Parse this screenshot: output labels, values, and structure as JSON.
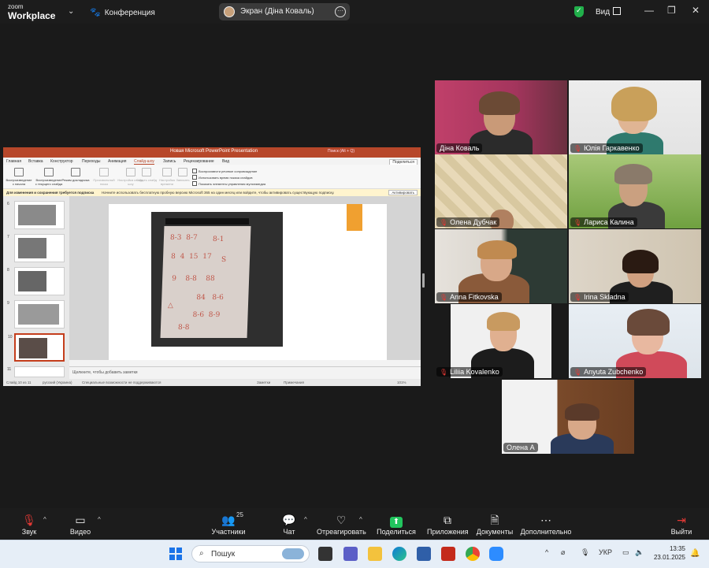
{
  "app": {
    "logo_top": "zoom",
    "logo_bottom": "Workplace",
    "conference_label": "Конференция",
    "screen_label": "Экран (Діна Коваль)",
    "view_label": "Вид"
  },
  "presentation": {
    "window_title": "Новая Microsoft PowerPoint Presentation",
    "search_hint": "Поиск (Alt + Q)",
    "tabs": [
      "Главная",
      "Вставка",
      "Конструктор",
      "Переходы",
      "Анимация",
      "Слайд-шоу",
      "Запись",
      "Рецензирование",
      "Вид"
    ],
    "active_tab": "Слайд-шоу",
    "share_button": "Поделиться",
    "ribbon": {
      "from_start": "Воспроизведение с начала",
      "from_current": "Воспроизведение с текущего слайда",
      "presenter": "Режим докладчика",
      "custom_show": "Произвольный показ",
      "setup": "Настройка слайд-шоу",
      "hide": "Скрыть слайд",
      "rehearse": "Настройка времени",
      "record": "Записать",
      "check1": "Воспроизвести речевое сопровождение",
      "check2": "Использовать время показа слайдов",
      "check3": "Показать элементы управления мультимедиа"
    },
    "message_bold": "Для изменения и сохранения требуется подписка",
    "message_text": "Начните использовать бесплатную пробную версию Microsoft 365 на один месяц или войдите, чтобы активировать существующую подписку.",
    "message_action": "Активировать",
    "thumb_numbers": [
      "6",
      "7",
      "8",
      "9",
      "10",
      "11"
    ],
    "selected_slide": "10",
    "notes_hint": "Щелкните, чтобы добавить заметки",
    "status_slide": "Слайд 10 из 11",
    "status_lang": "русский (Украина)",
    "status_access": "Специальные возможности не поддерживаются",
    "status_notes": "Заметки",
    "status_comments": "Примечания",
    "zoom_level": "101%"
  },
  "participants": [
    {
      "name": "Діна Коваль",
      "muted": false,
      "speaking": true
    },
    {
      "name": "Юлія Гаркавенко",
      "muted": true,
      "speaking": false
    },
    {
      "name": "Олена Дубчак",
      "muted": true,
      "speaking": false
    },
    {
      "name": "Лариса Калина",
      "muted": true,
      "speaking": false
    },
    {
      "name": "Anna Fitkovska",
      "muted": true,
      "speaking": false
    },
    {
      "name": "Irina Skladna",
      "muted": true,
      "speaking": false
    },
    {
      "name": "Liliia Kovalenko",
      "muted": true,
      "speaking": false
    },
    {
      "name": "Anyuta Zubchenko",
      "muted": true,
      "speaking": false
    },
    {
      "name": "Олена А",
      "muted": false,
      "speaking": false
    }
  ],
  "toolbar": {
    "audio": "Звук",
    "video": "Видео",
    "participants": "Участники",
    "participants_count": "25",
    "chat": "Чат",
    "react": "Отреагировать",
    "share": "Поделиться",
    "apps": "Приложения",
    "docs": "Документы",
    "more": "Дополнительно",
    "leave": "Выйти"
  },
  "taskbar": {
    "search_placeholder": "Пошук",
    "lang": "УКР",
    "time": "13:35",
    "date": "23.01.2025"
  },
  "colors": {
    "speaking_border": "#22c55e",
    "share_green": "#22c55e",
    "ppt_accent": "#b7472a",
    "muted_red": "#e53935"
  }
}
